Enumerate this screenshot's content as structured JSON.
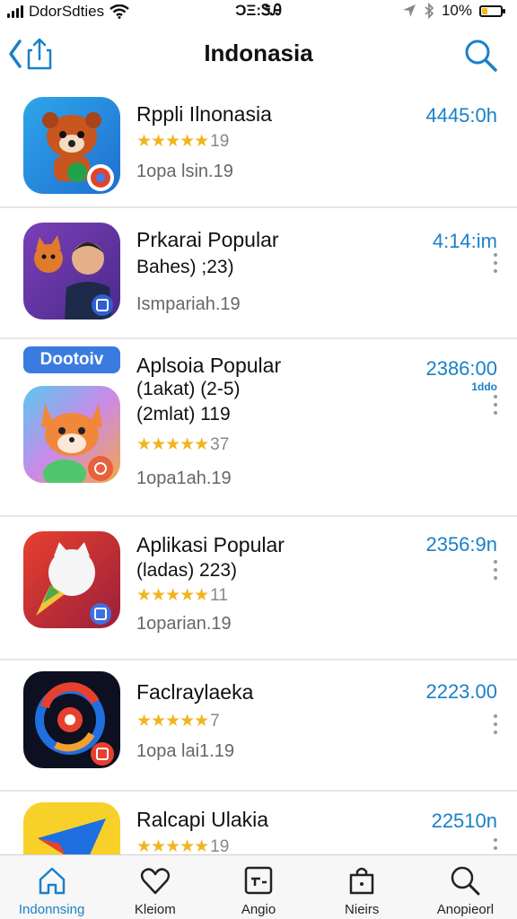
{
  "status": {
    "carrier": "DdorSdties",
    "time": "ϽΞ:ᏕᎯ",
    "battery_pct": "10%",
    "battery_level": 0.3
  },
  "nav": {
    "title": "Indonasia",
    "back_icon": "back-share-icon",
    "search_icon": "search-icon"
  },
  "apps": [
    {
      "name": "Rppli Ilnonasia",
      "stars": "★★★★★",
      "rating": "19",
      "meta": "1opa lsin.19",
      "price": "4445:0h",
      "icon": "red-panda-icon"
    },
    {
      "name": "Prkarai Popular",
      "sub": "Bahes) ;23)",
      "meta": "Ismpariah.19",
      "price": "4:14:im",
      "icon": "person-fox-icon"
    },
    {
      "badge": "Dootoiv",
      "name": "Aplsoia Popular",
      "sub": "(1akat) (2-5)",
      "sub2": "(2mlat) 119",
      "stars": "★★★★★",
      "rating": "37",
      "meta": "1opa1ah.19",
      "price": "2386:00",
      "price_sub": "1ddo",
      "icon": "fox-icon"
    },
    {
      "name": "Aplikasi Popular",
      "sub": "(ladas) 223)",
      "stars": "★★★★★",
      "rating": "11",
      "meta": "1oparian.19",
      "price": "2356:9n",
      "icon": "white-cat-icon"
    },
    {
      "name": "Faclraylaeka",
      "stars": "★★★★★",
      "rating": "7",
      "meta": "1opa lai1.19",
      "price": "2223.00",
      "icon": "swirl-icon"
    },
    {
      "name": "Ralcapi Ulakia",
      "stars": "★★★★★",
      "rating": "19",
      "price": "22510n",
      "icon": "paper-plane-icon"
    }
  ],
  "tabs": [
    {
      "label": "Indonnsing",
      "icon": "home-icon",
      "active": true
    },
    {
      "label": "Kleiom",
      "icon": "heart-icon",
      "active": false
    },
    {
      "label": "Angio",
      "icon": "window-icon",
      "active": false
    },
    {
      "label": "Nieirs",
      "icon": "bag-icon",
      "active": false
    },
    {
      "label": "Anopieorl",
      "icon": "search-icon",
      "active": false
    }
  ],
  "colors": {
    "accent": "#1a80c8",
    "star": "#f2b51f"
  }
}
